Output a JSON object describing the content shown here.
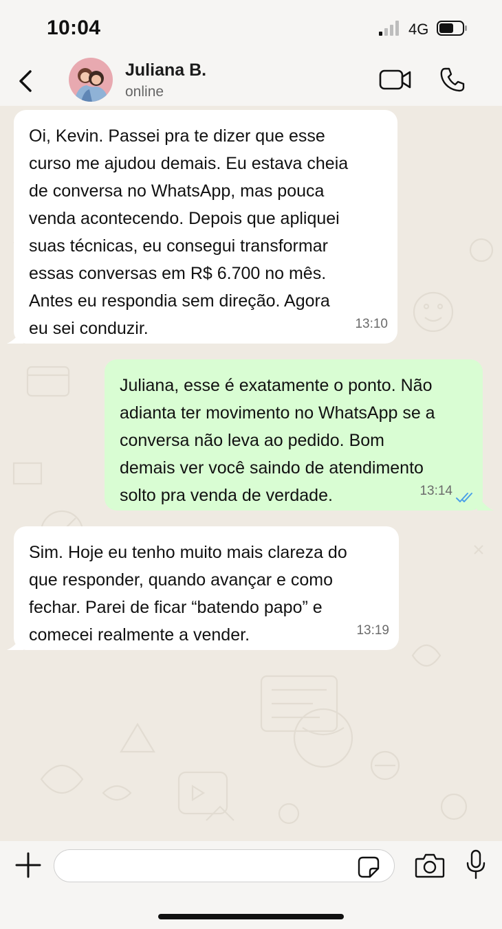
{
  "status_bar": {
    "time": "10:04",
    "network": "4G"
  },
  "header": {
    "contact_name": "Juliana B.",
    "contact_status": "online"
  },
  "messages": [
    {
      "direction": "incoming",
      "text": "Oi, Kevin. Passei pra te dizer que esse\ncurso me ajudou demais. Eu estava cheia\nde conversa no WhatsApp, mas pouca\nvenda acontecendo. Depois que apliquei\nsuas técnicas, eu consegui transformar\nessas conversas em R$ 6.700 no mês.\nAntes eu respondia sem direção. Agora\neu sei conduzir.",
      "time": "13:10"
    },
    {
      "direction": "outgoing",
      "text": "Juliana, esse é exatamente o ponto. Não\nadianta ter movimento no WhatsApp se a\nconversa não leva ao pedido. Bom\ndemais ver você saindo de atendimento\nsolto pra venda de verdade.",
      "time": "13:14",
      "read": true
    },
    {
      "direction": "incoming",
      "text": "Sim. Hoje eu tenho muito mais clareza do\nque responder, quando avançar e como\nfechar. Parei de ficar “batendo papo” e\ncomecei realmente a vender.",
      "time": "13:19"
    }
  ],
  "input": {
    "value": "",
    "placeholder": ""
  },
  "colors": {
    "incoming_bubble": "#ffffff",
    "outgoing_bubble": "#d9fdd3",
    "read_ticks": "#4a9fe8",
    "chat_background": "#efeae2"
  },
  "icons": [
    "back-arrow-icon",
    "video-call-icon",
    "phone-icon",
    "plus-icon",
    "sticker-icon",
    "camera-icon",
    "mic-icon"
  ]
}
